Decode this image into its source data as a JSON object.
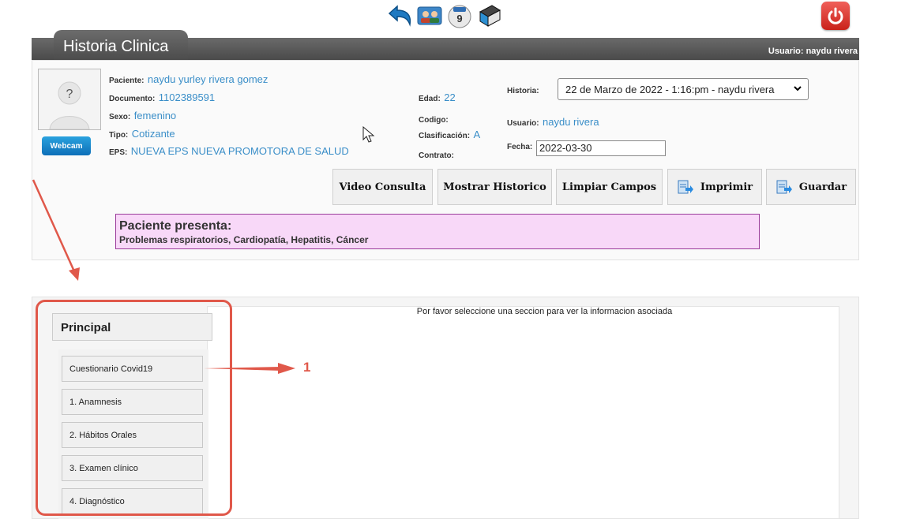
{
  "toolbar": {
    "icons": [
      "back-arrow-icon",
      "patients-icon",
      "calendar-icon",
      "book-icon"
    ],
    "calendar_day": "9",
    "power_icon": "power-icon"
  },
  "header": {
    "title": "Historia Clinica",
    "user_label": "Usuario: naydu rivera"
  },
  "patient": {
    "avatar_placeholder": "?",
    "webcam_label": "Webcam",
    "paciente_label": "Paciente:",
    "paciente_value": "naydu yurley rivera gomez",
    "documento_label": "Documento:",
    "documento_value": "1102389591",
    "sexo_label": "Sexo:",
    "sexo_value": "femenino",
    "tipo_label": "Tipo:",
    "tipo_value": "Cotizante",
    "eps_label": "EPS:",
    "eps_value": "NUEVA EPS NUEVA PROMOTORA DE SALUD",
    "edad_label": "Edad:",
    "edad_value": "22",
    "codigo_label": "Codigo:",
    "clasificacion_label": "Clasificación:",
    "clasificacion_value": "A",
    "contrato_label": "Contrato:",
    "historia_label": "Historia:",
    "historia_value": "22 de Marzo de 2022 - 1:16:pm - naydu rivera",
    "usuario_label": "Usuario:",
    "usuario_value": "naydu rivera",
    "fecha_label": "Fecha:",
    "fecha_value": "2022-03-30"
  },
  "actions": {
    "video": "Video Consulta",
    "historico": "Mostrar Historico",
    "limpiar": "Limpiar Campos",
    "imprimir": "Imprimir",
    "guardar": "Guardar"
  },
  "alert": {
    "title": "Paciente presenta:",
    "text": "Problemas respiratorios, Cardiopatía, Hepatitis, Cáncer"
  },
  "content": {
    "message": "Por favor seleccione una seccion para ver la informacion asociada"
  },
  "menu": {
    "header": "Principal",
    "items": [
      {
        "label": "Cuestionario Covid19"
      },
      {
        "label": "1. Anamnesis"
      },
      {
        "label": "2. Hábitos Orales"
      },
      {
        "label": "3. Examen clínico"
      },
      {
        "label": "4. Diagnóstico"
      }
    ]
  },
  "annotation": {
    "marker": "1",
    "color": "#e0584a"
  },
  "colors": {
    "link_blue": "#3a8ec8",
    "header_gray": "#5a5a5a",
    "alert_bg": "#f8d8f8",
    "alert_border": "#9a3a9a"
  }
}
